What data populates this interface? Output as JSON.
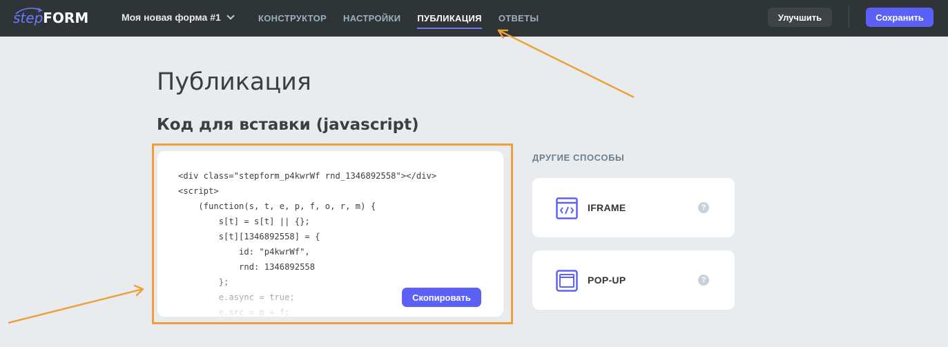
{
  "app": {
    "logo_step": "step",
    "logo_form": "FORM",
    "form_name": "Моя новая форма #1"
  },
  "nav": {
    "items": [
      {
        "label": "КОНСТРУКТОР",
        "active": false
      },
      {
        "label": "НАСТРОЙКИ",
        "active": false
      },
      {
        "label": "ПУБЛИКАЦИЯ",
        "active": true
      },
      {
        "label": "ОТВЕТЫ",
        "active": false
      }
    ],
    "improve_label": "Улучшить",
    "save_label": "Сохранить"
  },
  "main": {
    "page_title": "Публикация",
    "section_title": "Код для вставки (javascript)",
    "code_lines": [
      "<div class=\"stepform_p4kwrWf rnd_1346892558\"></div>",
      "<script>",
      "    (function(s, t, e, p, f, o, r, m) {",
      "        s[t] = s[t] || {};",
      "        s[t][1346892558] = {",
      "            id: \"p4kwrWf\",",
      "            rnd: 1346892558",
      "        };",
      "        e.async = true;",
      "        e.src = p + f;"
    ],
    "copy_label": "Скопировать"
  },
  "other": {
    "title": "ДРУГИЕ СПОСОБЫ",
    "options": [
      {
        "label": "IFRAME",
        "icon": "code-window-icon",
        "help": "?"
      },
      {
        "label": "POP-UP",
        "icon": "popup-window-icon",
        "help": "?"
      }
    ]
  },
  "colors": {
    "accent": "#5b61f6",
    "topbar": "#2f3437",
    "annotation": "#f0a03a"
  }
}
